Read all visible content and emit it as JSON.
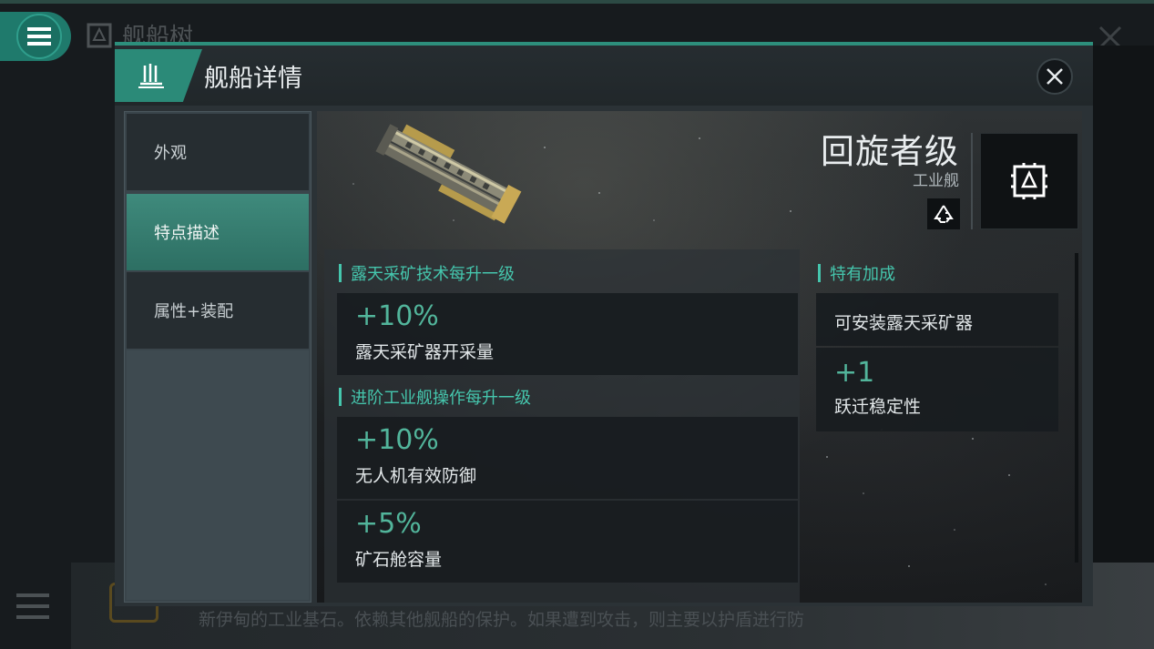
{
  "background": {
    "page_title": "舰船树",
    "description_text": "新伊甸的工业基石。依赖其他舰船的保护。如果遭到攻击，则主要以护盾进行防"
  },
  "modal": {
    "title": "舰船详情",
    "icon": "ship-tree-icon",
    "close_icon": "close-icon"
  },
  "tabs": [
    {
      "label": "外观",
      "active": false
    },
    {
      "label": "特点描述",
      "active": true
    },
    {
      "label": "属性+装配",
      "active": false
    }
  ],
  "ship": {
    "name": "回旋者级",
    "class": "工业舰",
    "recycle_icon": "recycle-icon",
    "class_icon": "industrial-class-icon"
  },
  "sections": [
    {
      "title": "露天采矿技术每升一级",
      "bonuses": [
        {
          "value": "+10%",
          "desc": "露天采矿器开采量"
        }
      ]
    },
    {
      "title": "进阶工业舰操作每升一级",
      "bonuses": [
        {
          "value": "+10%",
          "desc": "无人机有效防御"
        },
        {
          "value": "+5%",
          "desc": "矿石舱容量"
        }
      ]
    }
  ],
  "unique": {
    "title": "特有加成",
    "items": [
      {
        "value": "",
        "desc": "可安装露天采矿器"
      },
      {
        "value": "+1",
        "desc": "跃迁稳定性"
      }
    ]
  },
  "colors": {
    "accent": "#45c6ad",
    "bonus_value": "#52b59b",
    "header_tab": "#2b8a78"
  }
}
